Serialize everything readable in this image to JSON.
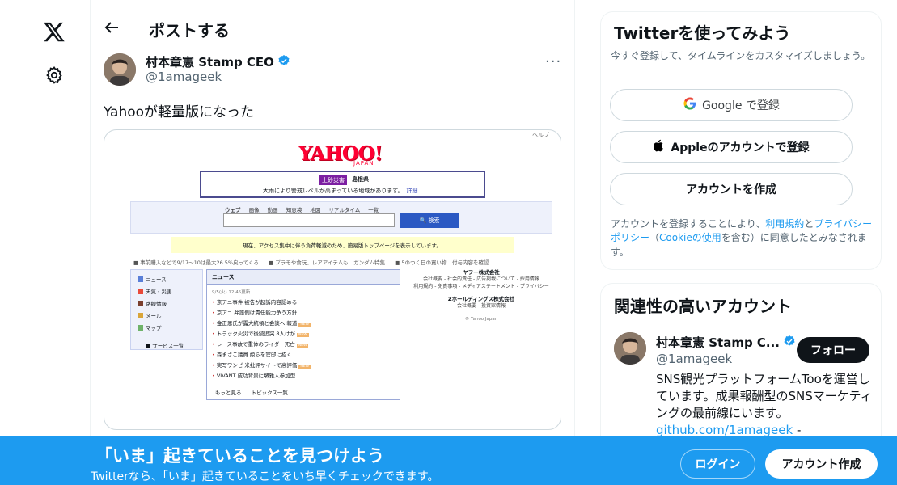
{
  "nav": {
    "logo_icon": "x-logo-icon",
    "settings_icon": "gear-icon"
  },
  "header": {
    "title": "ポストする"
  },
  "tweet": {
    "author_name": "村本章憲 Stamp CEO",
    "author_handle": "@1amageek",
    "text": "Yahooが軽量版になった",
    "more_label": "···"
  },
  "yahoo": {
    "help": "ヘルプ",
    "logo": "YAHOO!",
    "logo_sub": "JAPAN",
    "alert_tag": "土砂災害",
    "alert_region": "島根県",
    "alert_msg": "大雨により警戒レベルが高まっている地域があります。",
    "alert_link": "詳細",
    "tabs": [
      "ウェブ",
      "画像",
      "動画",
      "知恵袋",
      "地図",
      "リアルタイム",
      "一覧"
    ],
    "search_btn": "🔍 検索",
    "notice": "現在、アクセス集中に伴う負荷軽減のため、簡易版トップページを表示しています。",
    "promo": [
      "■ 事前購入などで9/17〜10は最大26.5%戻ってくる",
      "■ プラモや食玩、レアアイテムも　ガンダム特集",
      "■ 5のつく日の買い物　付与内容を確認"
    ],
    "side_items": [
      "ニュース",
      "天気・災害",
      "路線情報",
      "メール",
      "マップ"
    ],
    "side_foot": "サービス一覧",
    "news_head": "ニュース",
    "news_date": "9/5(火) 12:45更新",
    "news_items": [
      {
        "text": "京アニ事件 被告が起訴内容認める",
        "badge": ""
      },
      {
        "text": "京アニ 弁護側は責任能力争う方針",
        "badge": ""
      },
      {
        "text": "金正恩氏が露大統領と会談へ 報道",
        "badge": "NEW"
      },
      {
        "text": "トラック火災で後続追突 8人けが",
        "badge": "NEW"
      },
      {
        "text": "レース事故で重体のライダー死亡",
        "badge": "NEW"
      },
      {
        "text": "森まさこ議員 娘らを官邸に招く",
        "badge": ""
      },
      {
        "text": "実写ワンピ 米批評サイトで高評価",
        "badge": "NEW"
      },
      {
        "text": "VIVANT 成功背景に堺雅人参加型",
        "badge": ""
      }
    ],
    "news_more": "もっと見る",
    "news_topics": "トピックス一覧",
    "corp1": "ヤフー株式会社",
    "corp1_links": "会社概要 - 社会的責任 - 広告掲載について - 採用情報",
    "corp1_links2": "利用規約 - 免責事項 - メディアステートメント - プライバシー",
    "corp2": "Zホールディングス株式会社",
    "corp2_links": "会社概要 - 投資家情報",
    "copyright": "© Yahoo Japan"
  },
  "signup_card": {
    "title": "Twitterを使ってみよう",
    "subtitle": "今すぐ登録して、タイムラインをカスタマイズしましょう。",
    "google_label": "Google で登録",
    "apple_label": "Appleのアカウントで登録",
    "create_label": "アカウントを作成",
    "terms_pre": "アカウントを登録することにより、",
    "terms_link1": "利用規約",
    "terms_and": "と",
    "terms_link2": "プライバシーポリシー",
    "terms_paren_open": "（",
    "terms_link3": "Cookieの使用",
    "terms_post": "を含む）に同意したとみなされます。"
  },
  "related_card": {
    "title": "関連性の高いアカウント",
    "name": "村本章憲 Stamp C...",
    "handle": "@1amageek",
    "follow_label": "フォロー",
    "bio": "SNS観光プラットフォームTooを運営しています。成果報酬型のSNSマーケティングの最前線にいます。",
    "bio_link": "github.com/1amageek",
    "bio_link_suffix": " -"
  },
  "banner": {
    "title": "「いま」起きていることを見つけよう",
    "subtitle": "Twitterなら、「いま」起きていることをいち早くチェックできます。",
    "login_label": "ログイン",
    "signup_label": "アカウント作成"
  },
  "colors": {
    "accent": "#1d9bf0",
    "text": "#0f1419",
    "muted": "#536471",
    "yahoo_red": "#ff0033"
  }
}
